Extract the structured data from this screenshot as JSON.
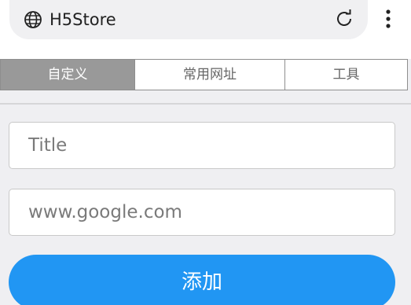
{
  "browser": {
    "site_title": "H5Store",
    "icons": {
      "site": "globe-icon",
      "reload": "reload-icon",
      "menu": "more-vert-icon"
    }
  },
  "tabs": [
    {
      "label": "自定义",
      "active": true
    },
    {
      "label": "常用网址",
      "active": false
    },
    {
      "label": "工具",
      "active": false
    }
  ],
  "form": {
    "title_placeholder": "Title",
    "url_placeholder": "www.google.com",
    "add_label": "添加"
  },
  "colors": {
    "accent": "#2196f3",
    "active_tab": "#999999",
    "background": "#efeff2"
  }
}
